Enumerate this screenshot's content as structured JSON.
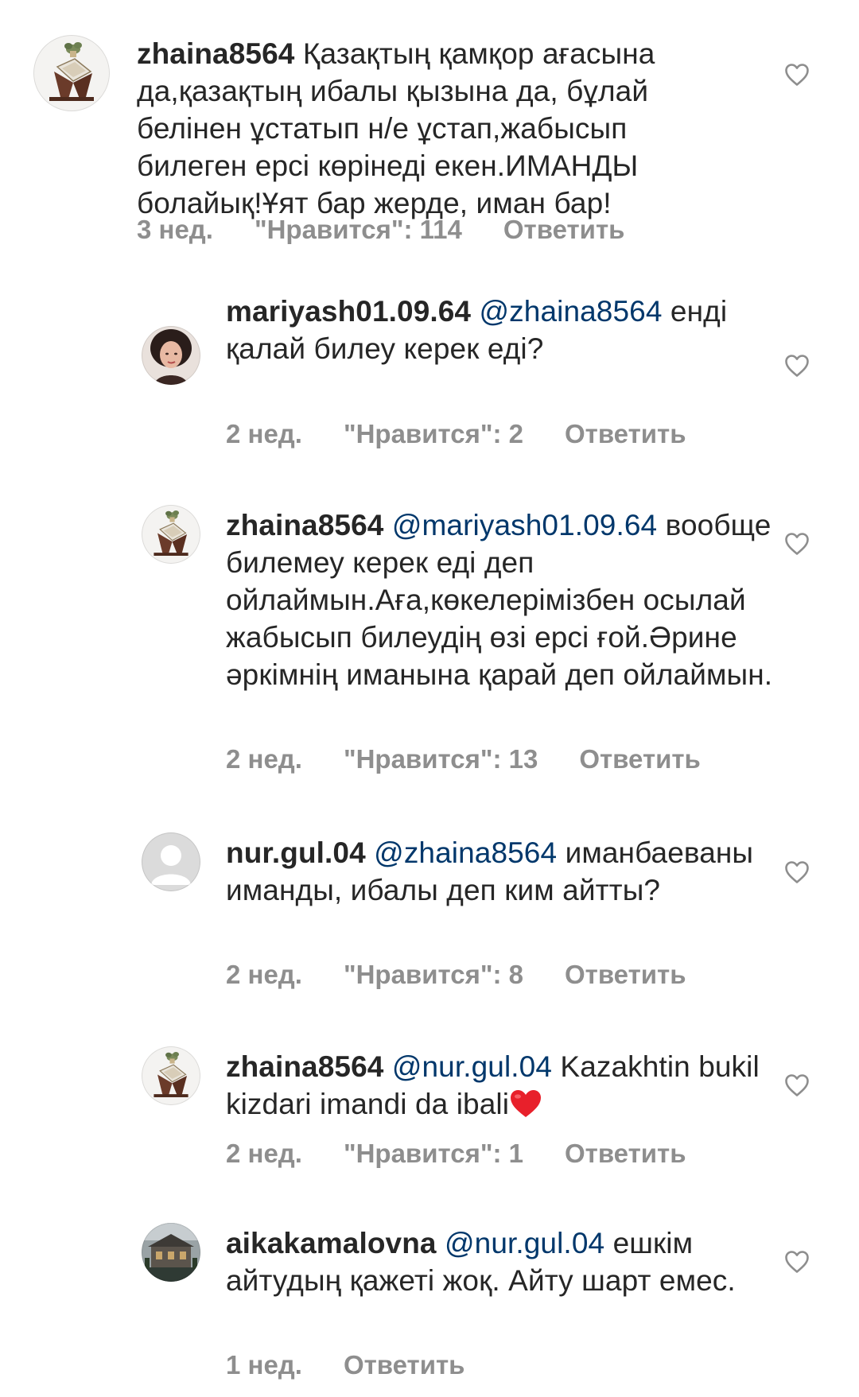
{
  "comments": [
    {
      "user": "zhaina8564",
      "mention": "",
      "text": "Қазақтың қамқор ағасына да,қазақтың ибалы қызына да, бұлай белінен ұстатып н/е ұстап,жабысып билеген ерсі көрінеді екен.ИМАНДЫ болайық!Ұят бар жерде, иман бар!",
      "time": "3 нед.",
      "likes": "\"Нравится\": 114",
      "reply": "Ответить",
      "avatar_icon": "quran-stand-avatar"
    },
    {
      "user": "mariyash01.09.64",
      "mention": "@zhaina8564",
      "text": "енді қалай билеу керек еді?",
      "time": "2 нед.",
      "likes": "\"Нравится\": 2",
      "reply": "Ответить",
      "avatar_icon": "woman-portrait-avatar"
    },
    {
      "user": "zhaina8564",
      "mention": "@mariyash01.09.64",
      "text": "вообще билемеу керек еді деп ойлаймын.Аға,көкелерімізбен осылай жабысып билеудің өзі ерсі ғой.Әрине әркімнің иманына қарай деп ойлаймын.",
      "time": "2 нед.",
      "likes": "\"Нравится\": 13",
      "reply": "Ответить",
      "avatar_icon": "quran-stand-avatar"
    },
    {
      "user": "nur.gul.04",
      "mention": "@zhaina8564",
      "text": "иманбаеваны иманды, ибалы деп ким айтты?",
      "time": "2 нед.",
      "likes": "\"Нравится\": 8",
      "reply": "Ответить",
      "avatar_icon": "default-user-avatar"
    },
    {
      "user": "zhaina8564",
      "mention": "@nur.gul.04",
      "text": "Kazakhtin bukil kizdari imandi da ibali",
      "time": "2 нед.",
      "likes": "\"Нравится\": 1",
      "reply": "Ответить",
      "avatar_icon": "quran-stand-avatar",
      "emoji": "red-heart-emoji"
    },
    {
      "user": "aikakamalovna",
      "mention": "@nur.gul.04",
      "text": "ешкім айтудың қажеті жоқ. Айту шарт емес.",
      "time": "1 нед.",
      "likes": "",
      "reply": "Ответить",
      "avatar_icon": "building-photo-avatar"
    }
  ],
  "colors": {
    "text": "#262626",
    "mention": "#00376b",
    "meta": "#8e8e8e",
    "heart_emoji": "#e8202b"
  }
}
